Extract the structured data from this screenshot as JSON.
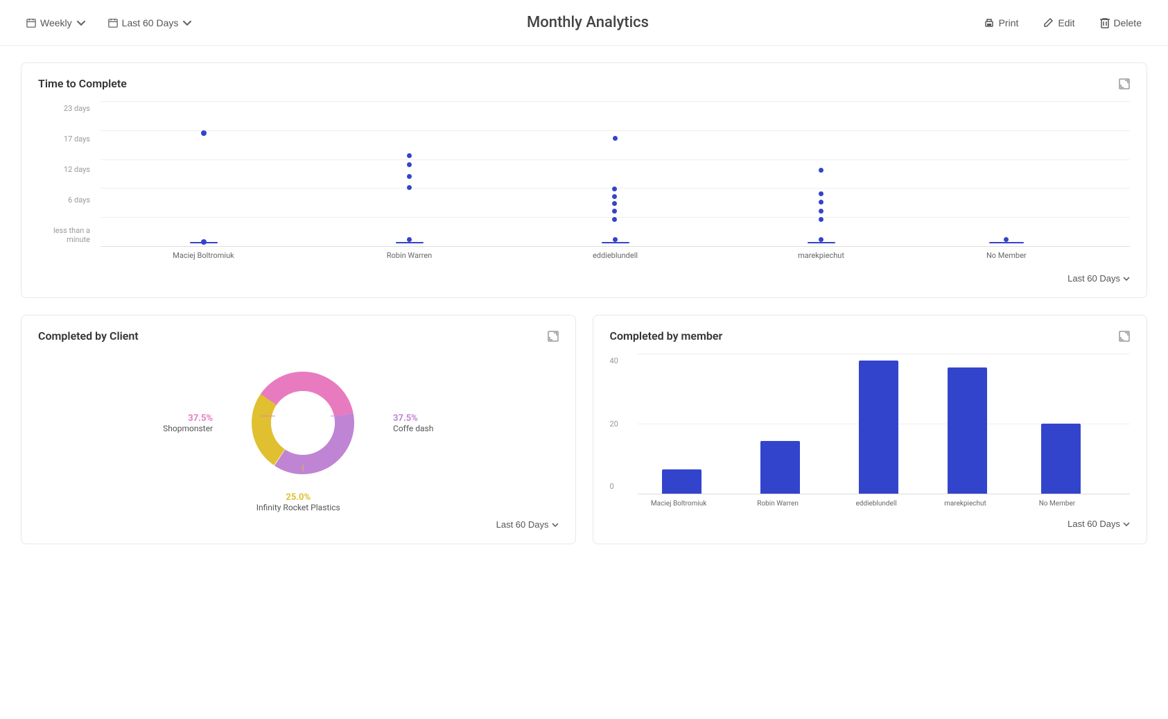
{
  "header": {
    "title": "Monthly Analytics",
    "weekly_label": "Weekly",
    "date_range_label": "Last 60 Days",
    "print_label": "Print",
    "edit_label": "Edit",
    "delete_label": "Delete"
  },
  "time_to_complete": {
    "title": "Time to Complete",
    "last60_label": "Last 60 Days",
    "y_labels": [
      "23 days",
      "17 days",
      "12 days",
      "6 days",
      "less than a minute"
    ],
    "members": [
      "Maciej Boltromiuk",
      "Robin Warren",
      "eddieblundell",
      "marekpiechut",
      "No Member"
    ]
  },
  "completed_by_client": {
    "title": "Completed by Client",
    "last60_label": "Last 60 Days",
    "segments": [
      {
        "label": "Shopmonster",
        "pct": "37.5%",
        "color": "#e87bbf",
        "class": "label-pink"
      },
      {
        "label": "Coffe dash",
        "pct": "37.5%",
        "color": "#c084d4",
        "class": "label-purple"
      },
      {
        "label": "Infinity Rocket Plastics",
        "pct": "25.0%",
        "color": "#e0c030",
        "class": "label-yellow"
      }
    ]
  },
  "completed_by_member": {
    "title": "Completed by member",
    "last60_label": "Last 60 Days",
    "y_labels": [
      "40",
      "20",
      "0"
    ],
    "bars": [
      {
        "member": "Maciej Boltromiuk",
        "value": 7,
        "max": 40
      },
      {
        "member": "Robin Warren",
        "value": 15,
        "max": 40
      },
      {
        "member": "eddieblundell",
        "value": 38,
        "max": 40
      },
      {
        "member": "marekpiechut",
        "value": 36,
        "max": 40
      },
      {
        "member": "No Member",
        "value": 20,
        "max": 40
      }
    ]
  }
}
